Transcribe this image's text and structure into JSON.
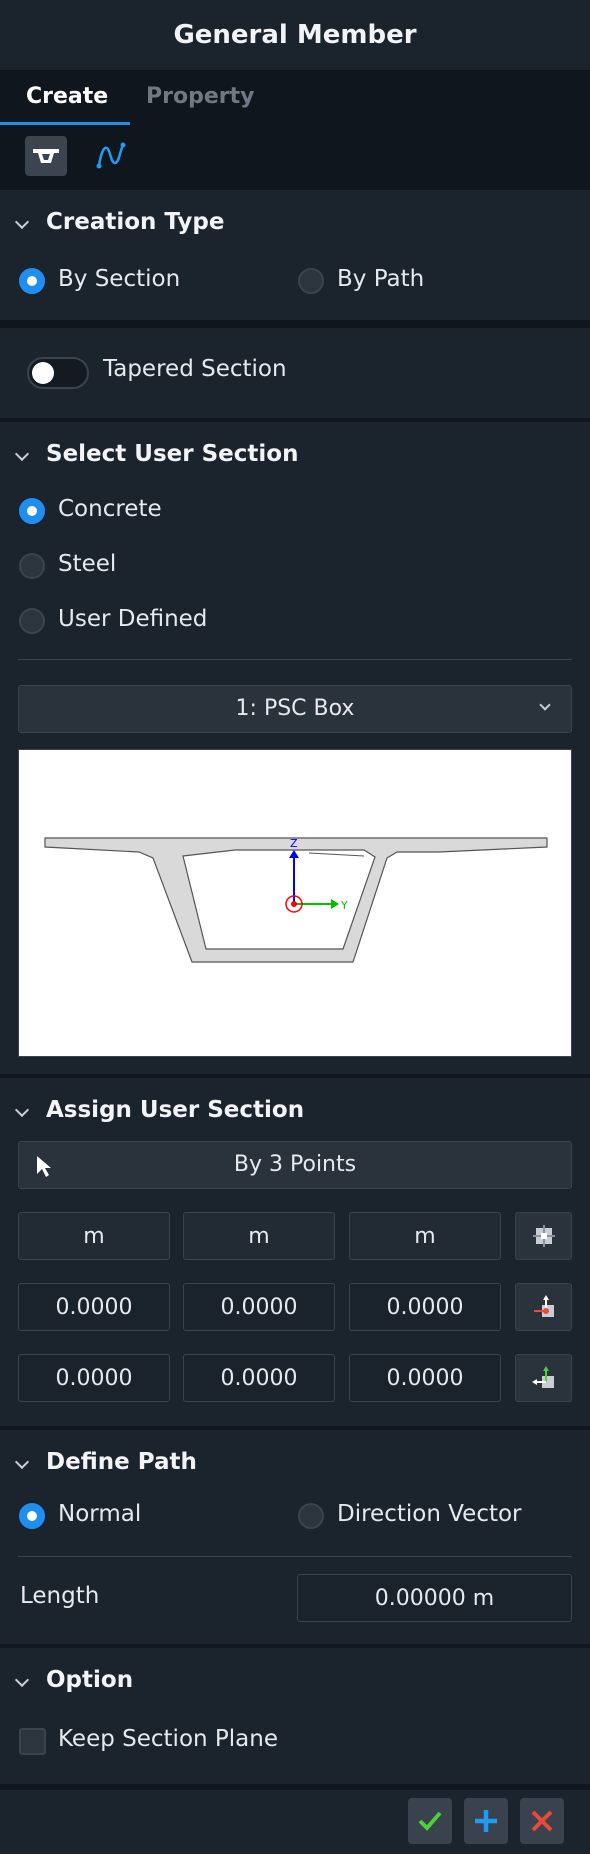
{
  "window": {
    "title": "General Member"
  },
  "tabs": [
    {
      "label": "Create",
      "active": true
    },
    {
      "label": "Property",
      "active": false
    }
  ],
  "modes": {
    "by_section_icon": "section-mode-icon",
    "by_path_icon": "path-mode-icon"
  },
  "creation_type": {
    "title": "Creation Type",
    "options": [
      {
        "label": "By Section",
        "selected": true
      },
      {
        "label": "By Path",
        "selected": false
      }
    ]
  },
  "tapered": {
    "label": "Tapered Section",
    "on": false
  },
  "select_user_section": {
    "title": "Select User Section",
    "options": [
      {
        "label": "Concrete",
        "selected": true
      },
      {
        "label": "Steel",
        "selected": false
      },
      {
        "label": "User Defined",
        "selected": false
      }
    ],
    "dropdown_value": "1: PSC Box",
    "preview_axes": {
      "z": "Z",
      "y": "Y"
    }
  },
  "assign_user_section": {
    "title": "Assign User Section",
    "method": "By 3 Points",
    "units": [
      "m",
      "m",
      "m"
    ],
    "row1": [
      "0.0000",
      "0.0000",
      "0.0000"
    ],
    "row2": [
      "0.0000",
      "0.0000",
      "0.0000"
    ]
  },
  "define_path": {
    "title": "Define Path",
    "options": [
      {
        "label": "Normal",
        "selected": true
      },
      {
        "label": "Direction Vector",
        "selected": false
      }
    ],
    "length_label": "Length",
    "length_value": "0.00000 m"
  },
  "option": {
    "title": "Option",
    "keep_plane_label": "Keep Section Plane",
    "keep_plane_checked": false
  },
  "colors": {
    "accent": "#1f8ef1",
    "ok": "#4cd137",
    "add": "#1f9cf0",
    "cancel": "#e84a3b"
  }
}
